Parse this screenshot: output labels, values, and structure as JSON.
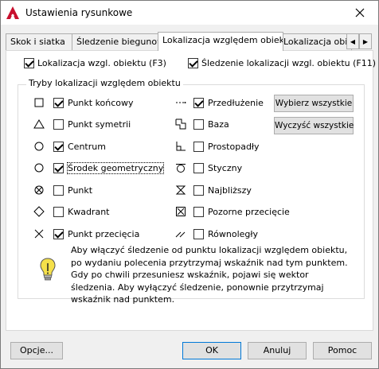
{
  "window": {
    "title": "Ustawienia rysunkowe"
  },
  "tabs": [
    {
      "label": "Skok i siatka"
    },
    {
      "label": "Śledzenie biegunowe"
    },
    {
      "label": "Lokalizacja względem obiektu"
    },
    {
      "label": "Lokalizacja obiek"
    }
  ],
  "top_options": {
    "osnap_on": {
      "label": "Lokalizacja wzgl. obiektu (F3)",
      "checked": true
    },
    "tracking_on": {
      "label": "Śledzenie lokalizacji wzgl. obiektu (F11)",
      "checked": true
    }
  },
  "group": {
    "title": "Tryby lokalizacji względem obiektu",
    "left": [
      {
        "label": "Punkt końcowy",
        "checked": true,
        "icon": "square-icon"
      },
      {
        "label": "Punkt symetrii",
        "checked": false,
        "icon": "triangle-icon"
      },
      {
        "label": "Centrum",
        "checked": true,
        "icon": "circle-icon"
      },
      {
        "label": "Środek geometryczny",
        "checked": true,
        "icon": "circle-icon"
      },
      {
        "label": "Punkt",
        "checked": false,
        "icon": "node-icon"
      },
      {
        "label": "Kwadrant",
        "checked": false,
        "icon": "diamond-icon"
      },
      {
        "label": "Punkt przecięcia",
        "checked": true,
        "icon": "cross-icon"
      }
    ],
    "right": [
      {
        "label": "Przedłużenie",
        "checked": true,
        "icon": "extension-icon"
      },
      {
        "label": "Baza",
        "checked": false,
        "icon": "insertion-icon"
      },
      {
        "label": "Prostopadły",
        "checked": false,
        "icon": "perpendicular-icon"
      },
      {
        "label": "Styczny",
        "checked": false,
        "icon": "tangent-icon"
      },
      {
        "label": "Najbliższy",
        "checked": false,
        "icon": "nearest-icon"
      },
      {
        "label": "Pozorne przecięcie",
        "checked": false,
        "icon": "apparent-intersection-icon"
      },
      {
        "label": "Równoległy",
        "checked": false,
        "icon": "parallel-icon"
      }
    ],
    "select_all": "Wybierz wszystkie",
    "clear_all": "Wyczyść wszystkie"
  },
  "info": {
    "text": "Aby włączyć śledzenie od punktu lokalizacji względem obiektu, po wydaniu polecenia przytrzymaj wskaźnik nad tym punktem. Gdy po chwili przesuniesz wskaźnik, pojawi się wektor śledzenia. Aby wyłączyć śledzenie, ponownie przytrzymaj wskaźnik nad punktem."
  },
  "buttons": {
    "options": "Opcje...",
    "ok": "OK",
    "cancel": "Anuluj",
    "help": "Pomoc"
  },
  "colors": {
    "accent": "#0078d7",
    "app_icon": "#c8102e"
  }
}
